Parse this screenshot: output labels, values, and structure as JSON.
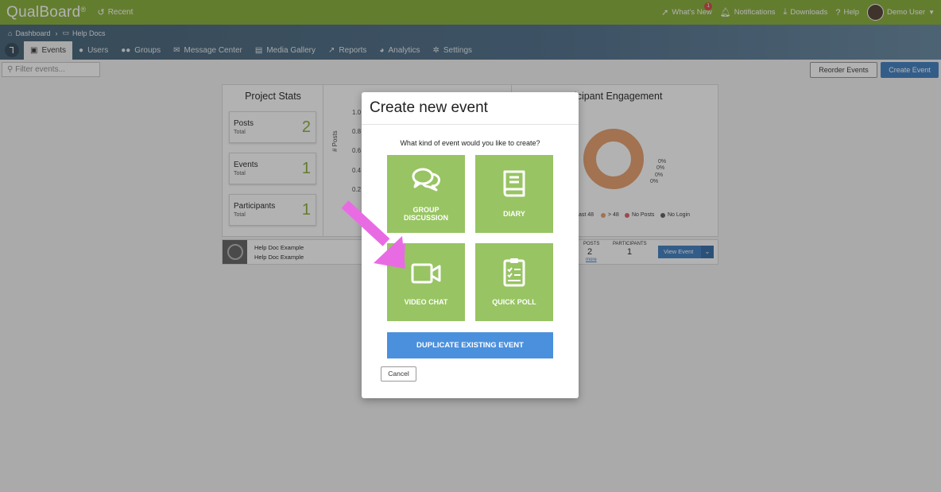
{
  "app": {
    "brand": "QualBoard",
    "brand_mark": "®",
    "recent_label": "Recent"
  },
  "top_right": {
    "whats_new": "What's New",
    "whats_new_badge": "1",
    "notifications": "Notifications",
    "downloads": "Downloads",
    "help": "Help",
    "user": "Demo User"
  },
  "breadcrumb": {
    "home": "Dashboard",
    "current": "Help Docs"
  },
  "tabs": [
    {
      "label": "Events",
      "icon": "calendar-icon",
      "active": true
    },
    {
      "label": "Users",
      "icon": "user-icon"
    },
    {
      "label": "Groups",
      "icon": "users-icon"
    },
    {
      "label": "Message Center",
      "icon": "envelope-icon"
    },
    {
      "label": "Media Gallery",
      "icon": "images-icon"
    },
    {
      "label": "Reports",
      "icon": "chart-icon"
    },
    {
      "label": "Analytics",
      "icon": "pie-icon"
    },
    {
      "label": "Settings",
      "icon": "gear-icon"
    }
  ],
  "toolbar": {
    "filter_placeholder": "Filter events...",
    "reorder_label": "Reorder Events",
    "create_label": "Create Event"
  },
  "dashboard": {
    "project_stats_title": "Project Stats",
    "stats": [
      {
        "label": "Posts",
        "sub": "Total",
        "value": "2"
      },
      {
        "label": "Events",
        "sub": "Total",
        "value": "1"
      },
      {
        "label": "Participants",
        "sub": "Total",
        "value": "1"
      }
    ],
    "mid_chart": {
      "y_label": "# Posts",
      "y_ticks": [
        "1.0",
        "0.8",
        "0.6",
        "0.4",
        "0.2"
      ]
    },
    "engagement_title": "Participant Engagement",
    "engagement_pcts": [
      "0%",
      "0%",
      "0%",
      "0%"
    ],
    "legend": [
      {
        "label": "ast 48",
        "color": "#e8a474"
      },
      {
        "label": "> 48",
        "color": "#e8a474"
      },
      {
        "label": "No Posts",
        "color": "#e06b6b"
      },
      {
        "label": "No Login",
        "color": "#666666"
      }
    ],
    "event_row": {
      "name": "Help Doc Example",
      "sub": "Help Doc Example",
      "posts_head": "POSTS",
      "posts_val": "2",
      "more": "more",
      "participants_head": "PARTICIPANTS",
      "participants_val": "1",
      "view_label": "View Event"
    }
  },
  "modal": {
    "title": "Create new event",
    "question": "What kind of event would you like to create?",
    "tiles": {
      "group_discussion_1": "GROUP",
      "group_discussion_2": "DISCUSSION",
      "diary": "DIARY",
      "video_chat": "VIDEO CHAT",
      "quick_poll": "QUICK POLL"
    },
    "duplicate_label": "DUPLICATE EXISTING EVENT",
    "cancel_label": "Cancel"
  },
  "colors": {
    "brand_green": "#8fb344",
    "tile_green": "#98c463",
    "primary_blue": "#4a90dd",
    "arrow_pink": "#e96be4"
  }
}
